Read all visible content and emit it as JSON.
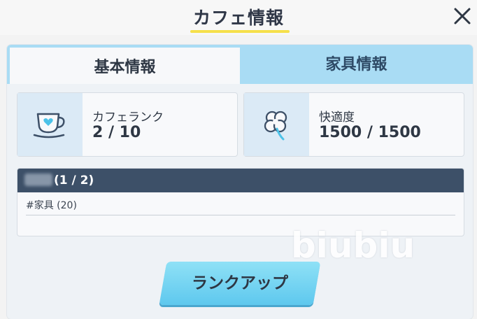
{
  "header": {
    "title": "カフェ情報",
    "close_icon": "close-icon"
  },
  "tabs": {
    "basic": "基本情報",
    "furniture": "家具情報"
  },
  "cards": {
    "rank": {
      "label": "カフェランク",
      "value": "2 / 10",
      "icon": "teacup-icon"
    },
    "comfort": {
      "label": "快適度",
      "value": "1500 / 1500",
      "icon": "clover-icon"
    }
  },
  "list": {
    "header_value": "(1 / 2)",
    "items": [
      "#家具 (20)"
    ]
  },
  "button": {
    "label": "ランクアップ"
  },
  "watermark": "biubiu",
  "colors": {
    "accent_yellow": "#f6e04a",
    "tab_active_bg": "#f7f8fa",
    "tab_inactive_bg": "#a9dcf4",
    "list_header_bg": "#3d5068",
    "button_bg": "#5ec8ee"
  }
}
